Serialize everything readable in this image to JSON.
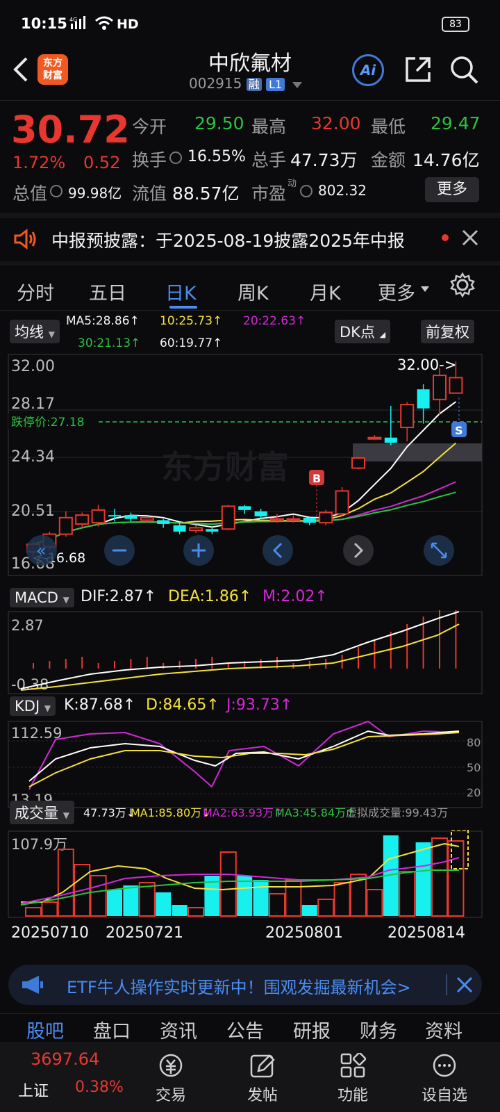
{
  "status_bar": {
    "time": "10:15",
    "network": "4G",
    "hd": "HD",
    "battery": "83"
  },
  "header": {
    "logo_line1": "东方",
    "logo_line2": "财富",
    "title": "中欣氟材",
    "code": "002915",
    "badge_margin": "融",
    "badge_level": "L1",
    "ai_label": "Ai"
  },
  "quote": {
    "price": "30.72",
    "change_pct": "1.72%",
    "change_amt": "0.52",
    "open_label": "今开",
    "open_value": "29.50",
    "high_label": "最高",
    "high_value": "32.00",
    "low_label": "最低",
    "low_value": "29.47",
    "turnover_label": "换手",
    "turnover_value": "16.55%",
    "volume_label": "总手",
    "volume_value": "47.73万",
    "amount_label": "金额",
    "amount_value": "14.76亿",
    "mktcap_label": "总值",
    "mktcap_value": "99.98亿",
    "float_label": "流值",
    "float_value": "88.57亿",
    "pe_label": "市盈",
    "pe_sup": "动",
    "pe_value": "802.32",
    "more_button": "更多"
  },
  "notice": {
    "text": "中报预披露：于2025-08-19披露2025年中报"
  },
  "tabs": [
    {
      "label": "分时"
    },
    {
      "label": "五日"
    },
    {
      "label": "日K"
    },
    {
      "label": "周K"
    },
    {
      "label": "月K"
    },
    {
      "label": "更多"
    }
  ],
  "ma_legend": {
    "selector": "均线",
    "ma5": "MA5:28.86↑",
    "ma10": "10:25.73↑",
    "ma20": "20:22.63↑",
    "ma30": "30:21.13↑",
    "ma60": "60:19.77↑",
    "dk_button": "DK点",
    "adjust_button": "前复权"
  },
  "kline": {
    "y_labels": [
      "32.00",
      "28.17",
      "24.34",
      "20.51",
      "16.68"
    ],
    "high_marker": "32.00->",
    "low_marker": "<-16.68",
    "limit_down_label": "跌停价:27.18",
    "watermark": "东方财富",
    "buy_marker": "B",
    "sell_marker": "S"
  },
  "macd": {
    "selector": "MACD",
    "dif": "DIF:2.87↑",
    "dea": "DEA:1.86↑",
    "m": "M:2.02↑",
    "y_top": "2.87",
    "y_bottom": "-0.38"
  },
  "kdj": {
    "selector": "KDJ",
    "k": "K:87.68↑",
    "d": "D:84.65↑",
    "j": "J:93.73↑",
    "y_top": "112.59",
    "y_bottom": "13.19",
    "r80": "80",
    "r50": "50",
    "r20": "20"
  },
  "volume": {
    "selector": "成交量",
    "vol": "47.73万↓",
    "ma1": "MA1:85.80万↓",
    "ma2": "MA2:63.93万↑",
    "ma3": "MA3:45.84万↑",
    "virtual": "虚拟成交量:99.43万",
    "y_top": "107.9万"
  },
  "x_dates": [
    "20250710",
    "20250721",
    "20250801",
    "20250814"
  ],
  "banner": {
    "text": "ETF牛人操作实时更新中！围观发掘最新机会>"
  },
  "bottom_tabs": [
    {
      "label": "股吧"
    },
    {
      "label": "盘口"
    },
    {
      "label": "资讯"
    },
    {
      "label": "公告"
    },
    {
      "label": "研报"
    },
    {
      "label": "财务"
    },
    {
      "label": "资料"
    }
  ],
  "index": {
    "name": "上证",
    "value": "3697.64",
    "change": "0.38%"
  },
  "bottom_nav": [
    {
      "label": "交易"
    },
    {
      "label": "发帖"
    },
    {
      "label": "功能"
    },
    {
      "label": "设自选"
    }
  ],
  "colors": {
    "up": "#e8372f",
    "down": "#18f0f0",
    "accent": "#4a8cf0",
    "ma5": "#ffffff",
    "ma10": "#f5e13b",
    "ma20": "#d02ad6",
    "ma30": "#2bc23f",
    "ma60": "#e0e0e0"
  },
  "chart_data": {
    "type": "candlestick",
    "candles": [
      {
        "o": 17.0,
        "c": 17.6,
        "h": 17.9,
        "l": 16.68,
        "up": true
      },
      {
        "o": 17.4,
        "c": 18.4,
        "h": 18.6,
        "l": 17.2,
        "up": true
      },
      {
        "o": 18.4,
        "c": 19.7,
        "h": 20.2,
        "l": 18.2,
        "up": true
      },
      {
        "o": 19.2,
        "c": 19.9,
        "h": 20.1,
        "l": 18.9,
        "up": true
      },
      {
        "o": 19.3,
        "c": 20.3,
        "h": 20.7,
        "l": 19.0,
        "up": true
      },
      {
        "o": 19.9,
        "c": 19.9,
        "h": 20.4,
        "l": 19.4,
        "up": false
      },
      {
        "o": 19.9,
        "c": 19.6,
        "h": 20.1,
        "l": 19.4,
        "up": false
      },
      {
        "o": 19.7,
        "c": 19.5,
        "h": 19.8,
        "l": 19.3,
        "up": true
      },
      {
        "o": 19.5,
        "c": 19.2,
        "h": 19.6,
        "l": 18.9,
        "up": false
      },
      {
        "o": 19.1,
        "c": 18.6,
        "h": 19.3,
        "l": 18.4,
        "up": false
      },
      {
        "o": 18.7,
        "c": 18.9,
        "h": 19.1,
        "l": 18.5,
        "up": true
      },
      {
        "o": 18.8,
        "c": 18.6,
        "h": 19.0,
        "l": 18.4,
        "up": false
      },
      {
        "o": 18.8,
        "c": 20.6,
        "h": 20.7,
        "l": 18.7,
        "up": true
      },
      {
        "o": 20.6,
        "c": 20.3,
        "h": 20.7,
        "l": 20.0,
        "up": false
      },
      {
        "o": 20.2,
        "c": 19.8,
        "h": 20.4,
        "l": 19.6,
        "up": false
      },
      {
        "o": 19.6,
        "c": 19.6,
        "h": 20.0,
        "l": 19.3,
        "up": true
      },
      {
        "o": 19.6,
        "c": 19.6,
        "h": 19.9,
        "l": 19.3,
        "up": true
      },
      {
        "o": 19.7,
        "c": 19.3,
        "h": 19.8,
        "l": 19.1,
        "up": false
      },
      {
        "o": 19.3,
        "c": 20.1,
        "h": 20.3,
        "l": 19.1,
        "up": true
      },
      {
        "o": 20.0,
        "c": 21.8,
        "h": 22.1,
        "l": 19.8,
        "up": true
      },
      {
        "o": 23.6,
        "c": 24.4,
        "h": 24.5,
        "l": 23.5,
        "up": true
      },
      {
        "o": 26.0,
        "c": 26.0,
        "h": 26.2,
        "l": 26.0,
        "up": true
      },
      {
        "o": 26.0,
        "c": 25.6,
        "h": 28.5,
        "l": 25.4,
        "up": false
      },
      {
        "o": 26.8,
        "c": 28.6,
        "h": 28.8,
        "l": 25.7,
        "up": true
      },
      {
        "o": 29.8,
        "c": 28.3,
        "h": 30.2,
        "l": 27.1,
        "up": false
      },
      {
        "o": 29.0,
        "c": 30.9,
        "h": 31.5,
        "l": 27.8,
        "up": true
      },
      {
        "o": 29.5,
        "c": 30.72,
        "h": 32.0,
        "l": 29.47,
        "up": true
      }
    ]
  }
}
